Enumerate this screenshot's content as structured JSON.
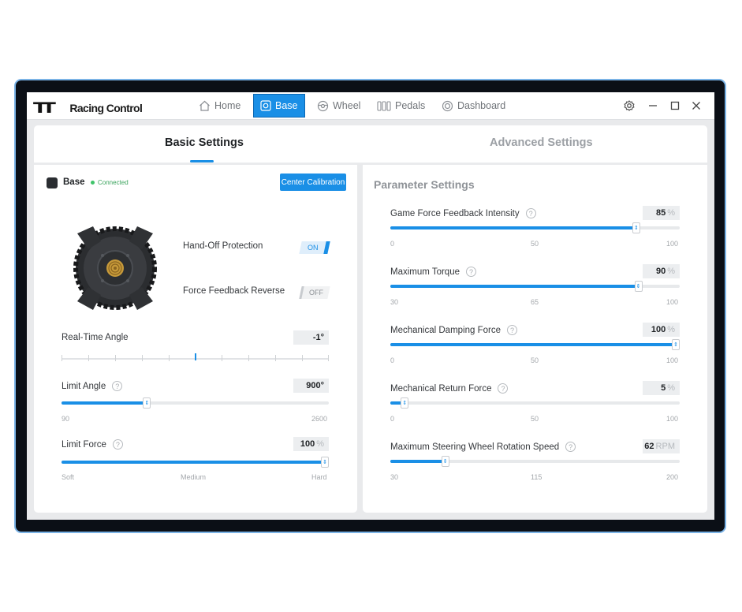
{
  "app": {
    "logo_mark": "TT",
    "name": "Racing Control"
  },
  "nav": [
    {
      "label": "Home",
      "icon": "home-icon"
    },
    {
      "label": "Base",
      "icon": "base-icon",
      "active": true
    },
    {
      "label": "Wheel",
      "icon": "wheel-icon"
    },
    {
      "label": "Pedals",
      "icon": "pedals-icon"
    },
    {
      "label": "Dashboard",
      "icon": "dashboard-icon"
    }
  ],
  "tabs": {
    "basic": "Basic Settings",
    "advanced": "Advanced Settings"
  },
  "left": {
    "title": "Base",
    "status": "Connected",
    "calib_button": "Center Calibration",
    "hand_off": {
      "label": "Hand-Off Protection",
      "state": "ON"
    },
    "ffb_reverse": {
      "label": "Force Feedback Reverse",
      "state": "OFF"
    },
    "realtime_angle": {
      "label": "Real-Time Angle",
      "value": "-1°",
      "fraction": 0.5
    },
    "limit_angle": {
      "label": "Limit Angle",
      "value": "900°",
      "min": "90",
      "max": "2600",
      "fraction": 0.32
    },
    "limit_force": {
      "label": "Limit Force",
      "value": "100",
      "unit": "%",
      "min": "Soft",
      "mid": "Medium",
      "max": "Hard",
      "fraction": 1.0
    }
  },
  "right": {
    "title": "Parameter Settings",
    "params": [
      {
        "label": "Game Force Feedback Intensity",
        "value": "85",
        "unit": "%",
        "min": "0",
        "mid": "50",
        "max": "100",
        "fraction": 0.85
      },
      {
        "label": "Maximum Torque",
        "value": "90",
        "unit": "%",
        "min": "30",
        "mid": "65",
        "max": "100",
        "fraction": 0.857
      },
      {
        "label": "Mechanical Damping Force",
        "value": "100",
        "unit": "%",
        "min": "0",
        "mid": "50",
        "max": "100",
        "fraction": 1.0
      },
      {
        "label": "Mechanical Return Force",
        "value": "5",
        "unit": "%",
        "min": "0",
        "mid": "50",
        "max": "100",
        "fraction": 0.05
      },
      {
        "label": "Maximum Steering Wheel Rotation Speed",
        "value": "62",
        "unit": "RPM",
        "min": "30",
        "mid": "115",
        "max": "200",
        "fraction": 0.19
      }
    ]
  },
  "colors": {
    "accent": "#1a8fe6",
    "status_green": "#3fc46a",
    "frame": "#7ab3e6"
  }
}
